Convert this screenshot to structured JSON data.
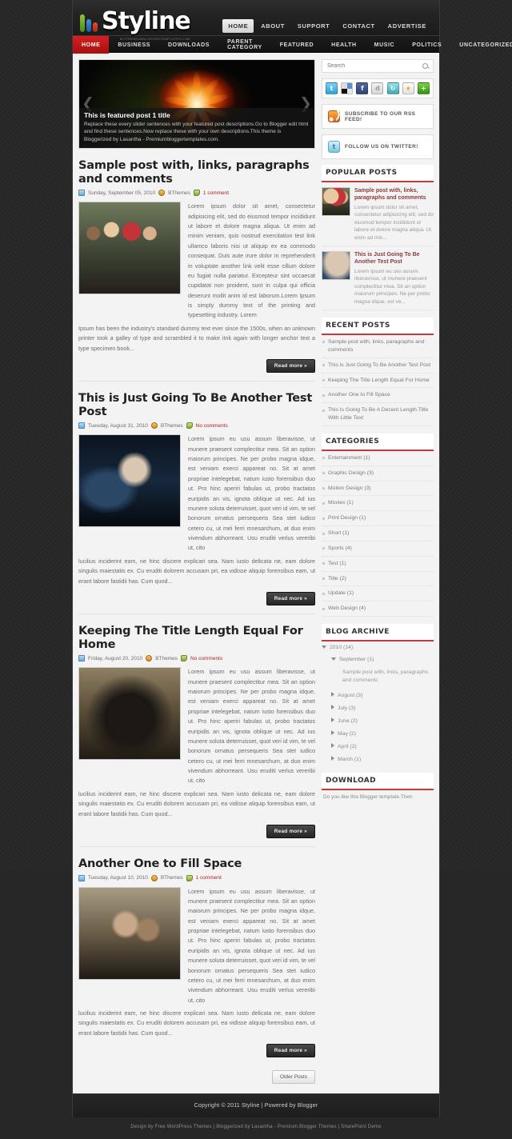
{
  "site": {
    "logo_text": "Styline",
    "logo_sub": "BY PREMIUMBLOGGERTEMPLATES.COM"
  },
  "top_nav": [
    {
      "label": "HOME",
      "active": true
    },
    {
      "label": "ABOUT",
      "active": false
    },
    {
      "label": "SUPPORT",
      "active": false
    },
    {
      "label": "CONTACT",
      "active": false
    },
    {
      "label": "ADVERTISE",
      "active": false
    }
  ],
  "main_nav": [
    {
      "label": "HOME",
      "active": true
    },
    {
      "label": "BUSINESS",
      "active": false
    },
    {
      "label": "DOWNLOADS",
      "active": false
    },
    {
      "label": "PARENT CATEGORY",
      "active": false
    },
    {
      "label": "FEATURED",
      "active": false
    },
    {
      "label": "HEALTH",
      "active": false
    },
    {
      "label": "MUSIC",
      "active": false
    },
    {
      "label": "POLITICS",
      "active": false
    },
    {
      "label": "UNCATEGORIZED",
      "active": false
    }
  ],
  "slider": {
    "title": "This is featured post 1 title",
    "description": "Replace these every slider sentences with your featured post descriptions.Go to Blogger edit html and find these sentences.Now replace these with your own descriptions.This theme is Bloggerized by Lasantha - Premiumbloggertemplates.com.",
    "prev_icon": "❮",
    "next_icon": "❯"
  },
  "posts": [
    {
      "title": "Sample post with, links, paragraphs and comments",
      "date": "Sunday, September 05, 2010",
      "author": "BThemes",
      "comments": "1 comment",
      "text": "Lorem ipsum dolor sit amet, consectetur adipisicing elit, sed do eiusmod tempor incididunt ut labore et dolore magna aliqua. Ut enim ad minim veniam, quis nostrud exercitation test link ullamco laboris nisi ut aliquip ex ea commodo consequat. Duis aute irure dolor in reprehenderit in voluptate another link velit esse cillum dolore eu fugiat nulla pariatur. Excepteur sint occaecat cupidatat non proident, sunt in culpa qui officia deserunt mollit anim id est laborum.Lorem Ipsum is simply dummy text of the printing and typesetting industry. Lorem",
      "text_below": "Ipsum has been the industry's standard dummy text ever since the 1500s, when an unknown printer took a galley of type and scrambled it to make itnk again with longer anchor text a type specimen book...",
      "read_more": "Read more »"
    },
    {
      "title": "This is Just Going To Be Another Test Post",
      "date": "Tuesday, August 31, 2010",
      "author": "BThemes",
      "comments": "No comments",
      "text": "Lorem ipsum eu usu assum liberavisse, ut munere praesent complectitur mea. Sit an option maiorum principes. Ne per probo magna idque, est veniam exerci appareat no. Sit at amet propriae intelegebat, natum iusto forensibus duo ut. Pro hinc aperiri fabulas ut, probo tractatos euripidis an vis, ignota oblique ut nec. Ad ius munere soluta deterruisset, quot veri id vim, te vel bonorum ornatus persequeris Sea stet iudico cetero cu, ut mei ferri mnesarchum, at duo enim vivendum abhorreant. Usu eruditi verlus vereribi ut, cito",
      "text_below": "lucilius inciderint eam, ne hinc discere explicari sea. Nam iusto delicata ne, eam dolore singulis maiestatis ex. Cu eruditi dolorem accusam pri, ea vidisse aliquip forensibus eam, ut erant labore fastidii has. Cum quod...",
      "read_more": "Read more »"
    },
    {
      "title": "Keeping The Title Length Equal For Home",
      "date": "Friday, August 20, 2010",
      "author": "BThemes",
      "comments": "No comments",
      "text": "Lorem ipsum eu usu assum liberavisse, ut munere praesent complectitur mea. Sit an option maiorum principes. Ne per probo magna idque, est veniam exerci appareat no. Sit at amet propriae intelegebat, natum iusto forensibus duo ut. Pro hinc aperiri fabulas ut, probo tractatos euripidis an vis, ignota oblique ut nec. Ad ius munere soluta deterruisset, quot veri id vim, te vel bonorum ornatus persequeris Sea stet iudico cetero cu, ut mei ferri mnesarchum, at duo enim vivendum abhorreant. Usu eruditi verlus vereribi ut, cito",
      "text_below": "lucilius inciderint eam, ne hinc discere explicari sea. Nam iusto delicata ne, eam dolore singulis maiestatis ex. Cu eruditi dolorem accusam pri, ea vidisse aliquip forensibus eam, ut erant labore fastidii has. Cum quod...",
      "read_more": "Read more »"
    },
    {
      "title": "Another One to Fill Space",
      "date": "Tuesday, August 10, 2010",
      "author": "BThemes",
      "comments": "1 comment",
      "text": "Lorem ipsum eu usu assum liberavisse, ut munere praesent complectitur mea. Sit an option maiorum principes. Ne per probo magna idque, est veniam exerci appareat no. Sit at amet propriae intelegebat, natum iusto forensibus duo ut. Pro hinc aperiri fabulas ut, probo tractatos euripidis an vis, ignota oblique ut nec. Ad ius munere soluta deterruisset, quot veri id vim, te vel bonorum ornatus persequeris Sea stet iudico cetero cu, ut mei ferri mnesarchum, at duo enim vivendum abhorreant. Usu eruditi verlus vereribi ut, cito",
      "text_below": "lucilius inciderint eam, ne hinc discere explicari sea. Nam iusto delicata ne, eam dolore singulis maiestatis ex. Cu eruditi dolorem accusam pri, ea vidisse aliquip forensibus eam, ut erant labore fastidii has. Cum quod...",
      "read_more": "Read more »"
    }
  ],
  "older_posts": "Older Posts",
  "sidebar": {
    "search_placeholder": "Search",
    "social_icons": [
      {
        "name": "twitter-icon",
        "glyph": "t"
      },
      {
        "name": "delicious-icon",
        "glyph": ""
      },
      {
        "name": "facebook-icon",
        "glyph": "f"
      },
      {
        "name": "digg-icon",
        "glyph": "d"
      },
      {
        "name": "stumbleupon-icon",
        "glyph": "↻"
      },
      {
        "name": "favorites-star-icon",
        "glyph": "★"
      },
      {
        "name": "add-share-icon",
        "glyph": "+"
      }
    ],
    "rss_label": "SUBSCRIBE TO OUR RSS FEED!",
    "twitter_label": "FOLLOW US ON TWITTER!",
    "popular_posts": {
      "title": "POPULAR POSTS",
      "items": [
        {
          "title": "Sample post with, links, paragraphs and comments",
          "desc": "Lorem ipsum dolor sit amet, consectetur adipisicing elit, sed do eiusmod tempor incididunt ut labore et dolore magna aliqua. Ut enim ad min..."
        },
        {
          "title": "This is Just Going To Be Another Test Post",
          "desc": "Lorem ipsum eu usu assum liberavisse, ut munere praesent complectitur mea. Sit an option maiorum principes. Ne per probo magna idque, est ve..."
        }
      ]
    },
    "recent_posts": {
      "title": "RECENT POSTS",
      "items": [
        "Sample post with, links, paragraphs and comments",
        "This is Just Going To Be Another Test Post",
        "Keeping The Title Length Equal For Home",
        "Another One to Fill Space",
        "This Is Going To Be A Decent Length Title With Little Text"
      ]
    },
    "categories": {
      "title": "CATEGORIES",
      "items": [
        "Entertainment (1)",
        "Graphic Design (3)",
        "Motion Design (3)",
        "Movies (1)",
        "Print Design (1)",
        "Short (1)",
        "Sports (4)",
        "Test (1)",
        "Title (2)",
        "Update (1)",
        "Web Design (4)"
      ]
    },
    "blog_archive": {
      "title": "BLOG ARCHIVE",
      "year": "2010 (14)",
      "month_open": "September (1)",
      "month_post": "Sample post with, links, paragraphs and comments",
      "months": [
        "August (3)",
        "July (3)",
        "June (2)",
        "May (2)",
        "April (2)",
        "March (1)"
      ]
    },
    "download": {
      "title": "DOWNLOAD",
      "text": "Do you like this Blogger template.Then"
    }
  },
  "footer": {
    "copyright": "Copyright © 2011 Styline | Powered by Blogger",
    "credits": "Design by Free WordPress Themes | Bloggerized by Lasantha - Premium Blogger Themes | SharePoint Demo"
  },
  "colors": {
    "accent_red": "#c23b3b",
    "nav_active_red": "#bd1a18",
    "page_bg": "#272727",
    "content_bg": "#f3f3f3"
  }
}
